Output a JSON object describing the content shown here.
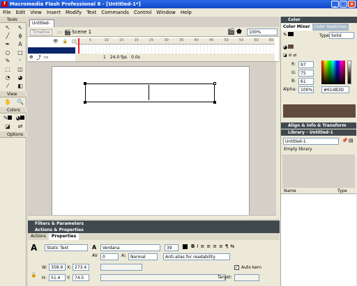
{
  "window": {
    "title": "Macromedia Flash Professional 8 - [Untitled-1*]",
    "min": "_",
    "max": "□",
    "close": "×"
  },
  "menu": [
    "File",
    "Edit",
    "View",
    "Insert",
    "Modify",
    "Text",
    "Commands",
    "Control",
    "Window",
    "Help"
  ],
  "tools": {
    "header": "Tools",
    "view_header": "View",
    "colors_header": "Colors",
    "options_header": "Options",
    "icons": [
      {
        "name": "selection-tool-icon",
        "glyph": "↖"
      },
      {
        "name": "subselection-tool-icon",
        "glyph": "⇖"
      },
      {
        "name": "line-tool-icon",
        "glyph": "╱"
      },
      {
        "name": "lasso-tool-icon",
        "glyph": "ϕ"
      },
      {
        "name": "pen-tool-icon",
        "glyph": "✒"
      },
      {
        "name": "text-tool-icon",
        "glyph": "A"
      },
      {
        "name": "oval-tool-icon",
        "glyph": "○"
      },
      {
        "name": "rectangle-tool-icon",
        "glyph": "□"
      },
      {
        "name": "pencil-tool-icon",
        "glyph": "✎"
      },
      {
        "name": "brush-tool-icon",
        "glyph": "ᐟ"
      },
      {
        "name": "free-transform-tool-icon",
        "glyph": "⬚"
      },
      {
        "name": "fill-transform-tool-icon",
        "glyph": "◫"
      },
      {
        "name": "ink-bottle-tool-icon",
        "glyph": "◔"
      },
      {
        "name": "paint-bucket-tool-icon",
        "glyph": "◕"
      },
      {
        "name": "eyedropper-tool-icon",
        "glyph": "⁄"
      },
      {
        "name": "eraser-tool-icon",
        "glyph": "◧"
      }
    ],
    "view_icons": [
      {
        "name": "hand-tool-icon",
        "glyph": "✋"
      },
      {
        "name": "zoom-tool-icon",
        "glyph": "🔍"
      }
    ]
  },
  "document": {
    "tab": "Untitled-1*",
    "timeline_button": "Timeline",
    "scene": "Scene 1",
    "zoom": "100%",
    "layer_name": "",
    "ruler_ticks": [
      "5",
      "10",
      "15",
      "20",
      "25",
      "30",
      "35",
      "40",
      "45",
      "50",
      "55",
      "60",
      "65"
    ],
    "frame": "1",
    "fps": "24.0 fps",
    "time": "0.0s"
  },
  "panels": {
    "filters": "Filters & Parameters",
    "actions_properties": "Actions & Properties",
    "tab_actions": "Actions",
    "tab_properties": "Properties"
  },
  "properties": {
    "text_type": "Static Text",
    "font": "Verdana",
    "size": "39",
    "tracking": "0",
    "char_position": "Normal",
    "anti_alias": "Anti-alias for readability",
    "w_label": "W:",
    "w": "358.9",
    "x_label": "X:",
    "x": "273.4",
    "h_label": "H:",
    "h": "51.4",
    "y_label": "Y:",
    "y": "74.5",
    "autokern": "Auto kern",
    "target": "Target:"
  },
  "color_panel": {
    "header": "Color",
    "tab_mixer": "Color Mixer",
    "tab_swatches": "Color Swatches",
    "type_label": "Type:",
    "type": "Solid",
    "r_label": "R:",
    "r": "97",
    "g_label": "G:",
    "g": "75",
    "b_label": "B:",
    "b": "61",
    "alpha_label": "Alpha:",
    "alpha": "100%",
    "hex": "#614B3D",
    "selected_color": "#614b3d"
  },
  "align_panel": {
    "header": "Align & Info & Transform"
  },
  "library_panel": {
    "header": "Library - Untitled-1",
    "doc_select": "Untitled-1",
    "empty": "Empty library",
    "col_name": "Name",
    "col_type": "Type"
  },
  "colors": {
    "accent": "#0a246a",
    "panel_dark": "#40494e",
    "chrome": "#ece9d8"
  }
}
